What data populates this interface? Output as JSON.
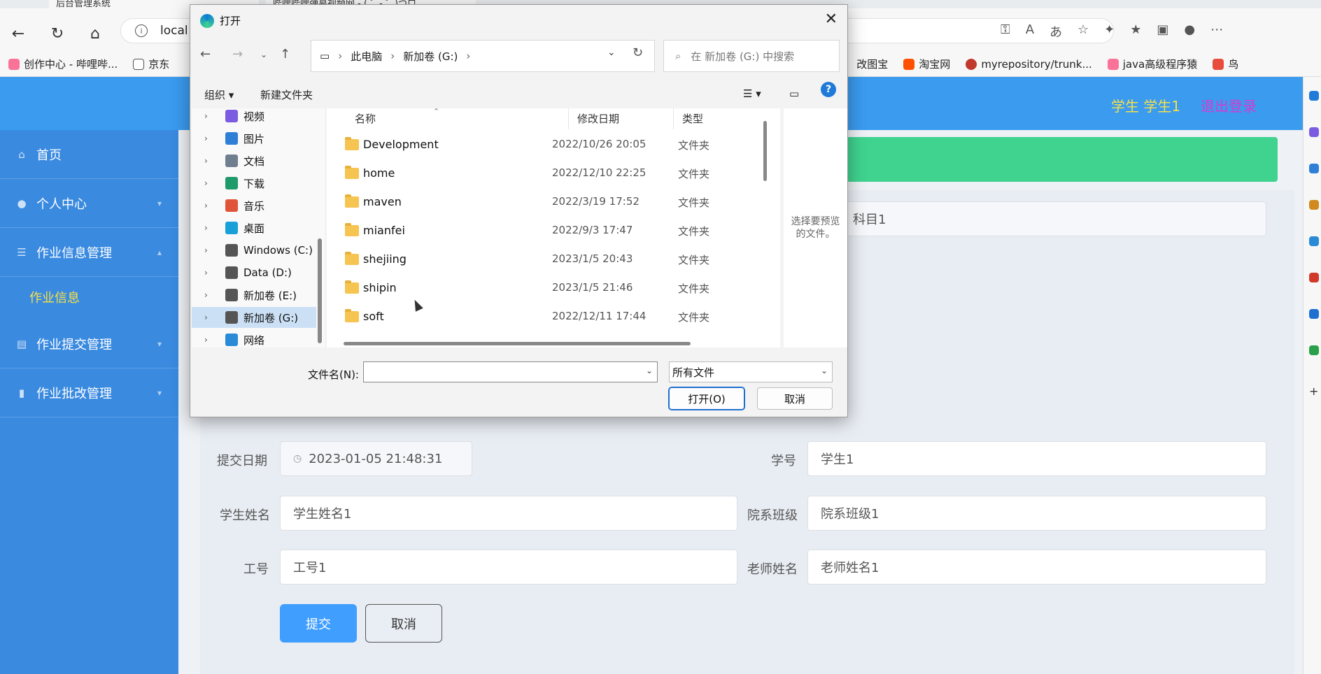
{
  "browser": {
    "tabs": [
      "后台管理系统",
      "哔哩哔哩弹幕视频网 - ( ゜- ゜)つロ"
    ],
    "address": "local",
    "bookmarks": [
      "创作中心 - 哔哩哔...",
      "京东",
      "改图宝",
      "淘宝网",
      "myrepository/trunk...",
      "java高级程序猿",
      "鸟"
    ]
  },
  "app": {
    "user_label": "学生 学生1",
    "logout": "退出登录",
    "menu": {
      "home": "首页",
      "personal": "个人中心",
      "homework_info_mgmt": "作业信息管理",
      "homework_info": "作业信息",
      "homework_submit_mgmt": "作业提交管理",
      "homework_grading_mgmt": "作业批改管理"
    },
    "form": {
      "subject_value": "科目1",
      "submit_date_label": "提交日期",
      "submit_date_value": "2023-01-05 21:48:31",
      "student_id_label": "学号",
      "student_id_value": "学生1",
      "student_name_label": "学生姓名",
      "student_name_value": "学生姓名1",
      "class_label": "院系班级",
      "class_value": "院系班级1",
      "staff_id_label": "工号",
      "staff_id_value": "工号1",
      "teacher_name_label": "老师姓名",
      "teacher_name_value": "老师姓名1",
      "submit_btn": "提交",
      "cancel_btn": "取消"
    }
  },
  "dialog": {
    "title": "打开",
    "path": [
      "此电脑",
      "新加卷 (G:)"
    ],
    "search_placeholder": "在 新加卷 (G:) 中搜索",
    "organize": "组织",
    "new_folder": "新建文件夹",
    "tree": [
      {
        "label": "视频",
        "color": "#7b5be0"
      },
      {
        "label": "图片",
        "color": "#2f7fd6"
      },
      {
        "label": "文档",
        "color": "#6f7f8f"
      },
      {
        "label": "下载",
        "color": "#1f9a6a"
      },
      {
        "label": "音乐",
        "color": "#e0553a"
      },
      {
        "label": "桌面",
        "color": "#1aa0d8"
      },
      {
        "label": "Windows (C:)",
        "color": "#555555"
      },
      {
        "label": "Data (D:)",
        "color": "#555555"
      },
      {
        "label": "新加卷 (E:)",
        "color": "#555555"
      },
      {
        "label": "新加卷 (G:)",
        "color": "#555555",
        "selected": true
      },
      {
        "label": "网络",
        "color": "#2a8ad6"
      }
    ],
    "columns": {
      "name": "名称",
      "date": "修改日期",
      "type": "类型"
    },
    "files": [
      {
        "name": "Development",
        "date": "2022/10/26 20:05",
        "type": "文件夹"
      },
      {
        "name": "home",
        "date": "2022/12/10 22:25",
        "type": "文件夹"
      },
      {
        "name": "maven",
        "date": "2022/3/19 17:52",
        "type": "文件夹"
      },
      {
        "name": "mianfei",
        "date": "2022/9/3 17:47",
        "type": "文件夹"
      },
      {
        "name": "shejiing",
        "date": "2023/1/5 20:43",
        "type": "文件夹"
      },
      {
        "name": "shipin",
        "date": "2023/1/5 21:46",
        "type": "文件夹"
      },
      {
        "name": "soft",
        "date": "2022/12/11 17:44",
        "type": "文件夹"
      }
    ],
    "preview_text": "选择要预览的文件。",
    "filename_label": "文件名(N):",
    "filename_value": "",
    "filter": "所有文件",
    "open_btn": "打开(O)",
    "cancel_btn": "取消"
  }
}
